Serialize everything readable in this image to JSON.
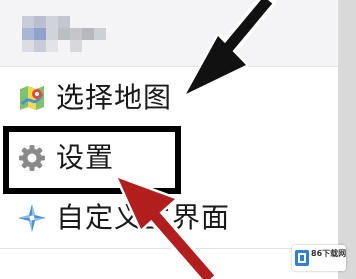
{
  "menu": {
    "items": [
      {
        "label": "选择地图",
        "icon": "map-icon"
      },
      {
        "label": "设置",
        "icon": "gear-icon"
      },
      {
        "label": "自定义主界面",
        "icon": "compass-star-icon"
      }
    ]
  },
  "annotations": {
    "highlight_color": "#000000",
    "black_arrow_color": "#111111",
    "red_arrow_color": "#b21e1e"
  },
  "watermark": {
    "text": "86下载网",
    "icon": "download-site-logo"
  }
}
